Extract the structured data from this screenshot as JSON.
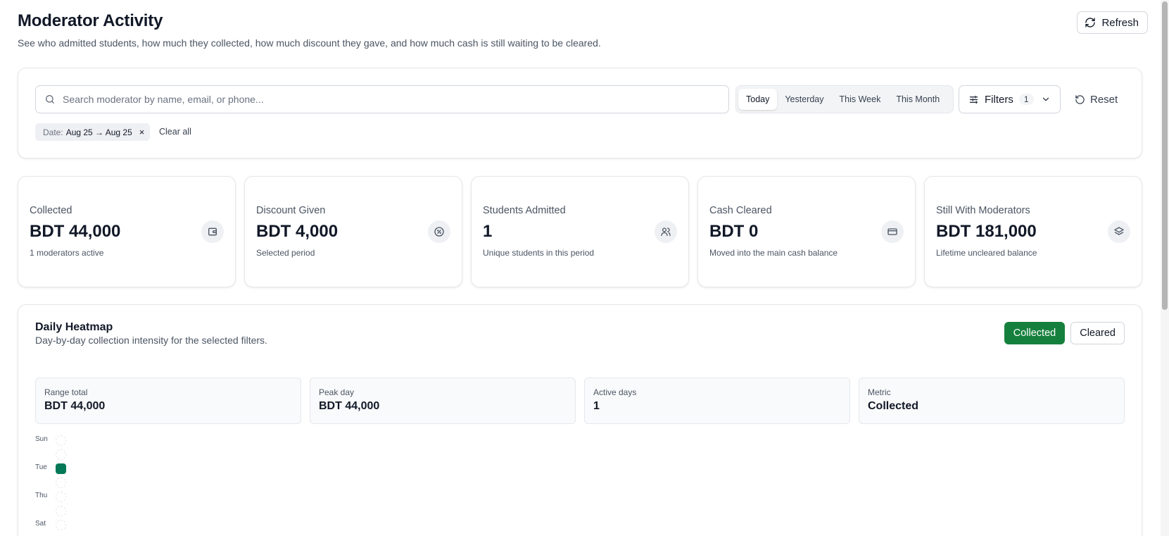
{
  "header": {
    "title": "Moderator Activity",
    "subtitle": "See who admitted students, how much they collected, how much discount they gave, and how much cash is still waiting to be cleared.",
    "refresh_label": "Refresh"
  },
  "filters": {
    "search_placeholder": "Search moderator by name, email, or phone...",
    "search_value": "",
    "range_tabs": [
      {
        "label": "Today",
        "active": true
      },
      {
        "label": "Yesterday",
        "active": false
      },
      {
        "label": "This Week",
        "active": false
      },
      {
        "label": "This Month",
        "active": false
      }
    ],
    "filters_label": "Filters",
    "filters_count": "1",
    "reset_label": "Reset",
    "chip": {
      "key": "Date:",
      "value": "Aug 25 → Aug 25",
      "close": "×"
    },
    "clear_all_label": "Clear all"
  },
  "stats": [
    {
      "label": "Collected",
      "value": "BDT 44,000",
      "note": "1 moderators active",
      "icon": "wallet-icon"
    },
    {
      "label": "Discount Given",
      "value": "BDT 4,000",
      "note": "Selected period",
      "icon": "percent-badge-icon"
    },
    {
      "label": "Students Admitted",
      "value": "1",
      "note": "Unique students in this period",
      "icon": "users-icon"
    },
    {
      "label": "Cash Cleared",
      "value": "BDT 0",
      "note": "Moved into the main cash balance",
      "icon": "credit-card-icon"
    },
    {
      "label": "Still With Moderators",
      "value": "BDT 181,000",
      "note": "Lifetime uncleared balance",
      "icon": "layers-icon"
    }
  ],
  "heatmap": {
    "title": "Daily Heatmap",
    "subtitle": "Day-by-day collection intensity for the selected filters.",
    "metric_buttons": [
      {
        "label": "Collected",
        "active": true
      },
      {
        "label": "Cleared",
        "active": false
      }
    ],
    "summary": [
      {
        "label": "Range total",
        "value": "BDT 44,000"
      },
      {
        "label": "Peak day",
        "value": "BDT 44,000"
      },
      {
        "label": "Active days",
        "value": "1"
      },
      {
        "label": "Metric",
        "value": "Collected"
      }
    ],
    "day_labels": [
      "Sun",
      "Tue",
      "Thu",
      "Sat"
    ],
    "cells": [
      {
        "day": "Sun",
        "active": false
      },
      {
        "day": "Mon",
        "active": false
      },
      {
        "day": "Tue",
        "active": true
      },
      {
        "day": "Wed",
        "active": false
      },
      {
        "day": "Thu",
        "active": false
      },
      {
        "day": "Fri",
        "active": false
      },
      {
        "day": "Sat",
        "active": false
      }
    ],
    "active_color": "#047857"
  },
  "colors": {
    "accent": "#15803d",
    "heat_filled": "#047857"
  }
}
